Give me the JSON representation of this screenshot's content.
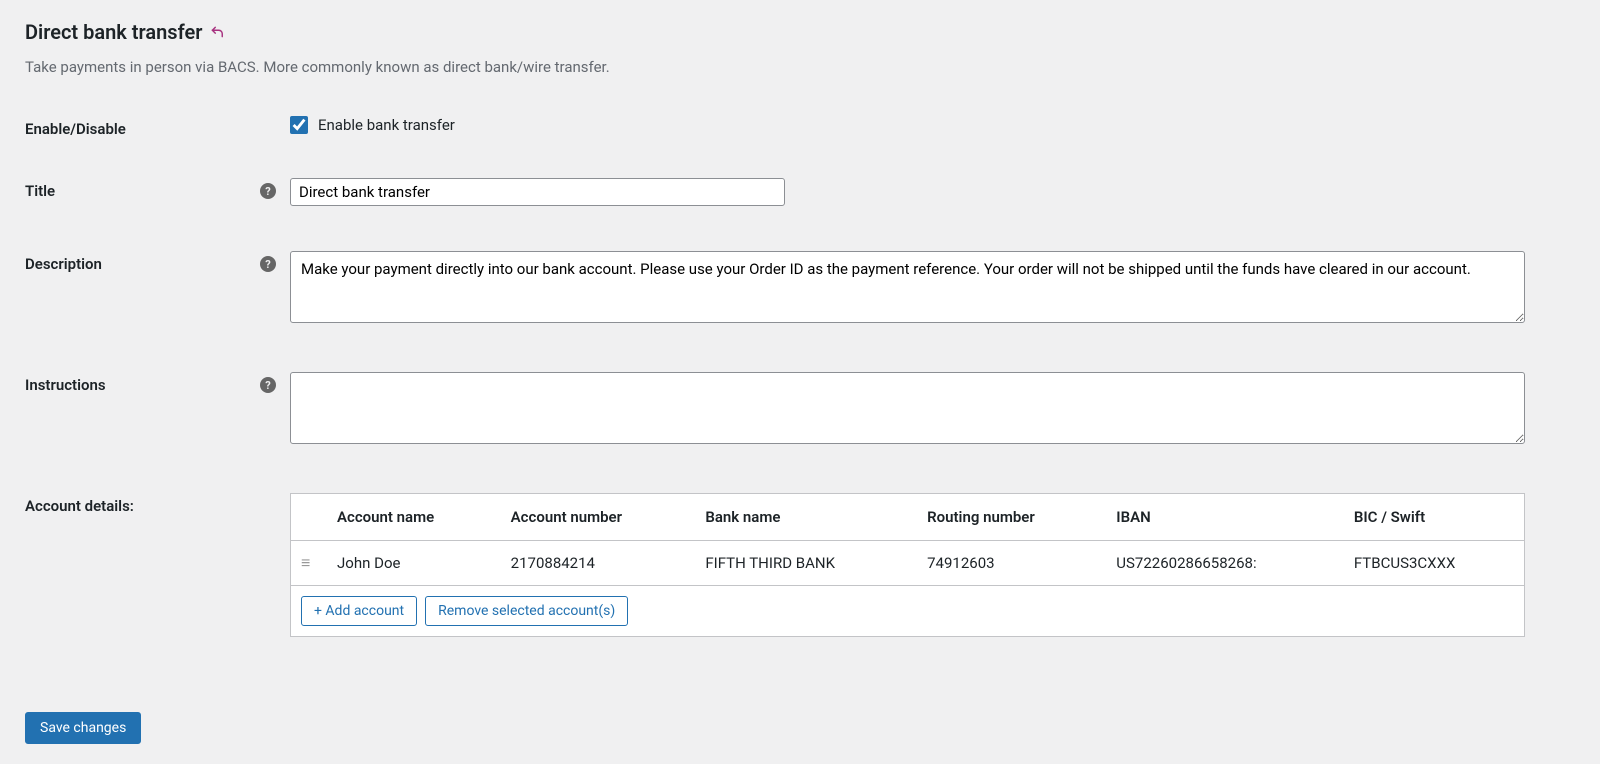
{
  "header": {
    "title": "Direct bank transfer",
    "subtitle": "Take payments in person via BACS. More commonly known as direct bank/wire transfer."
  },
  "form": {
    "enable_disable": {
      "label": "Enable/Disable",
      "checkbox_label": "Enable bank transfer",
      "checked": true
    },
    "title": {
      "label": "Title",
      "value": "Direct bank transfer"
    },
    "description": {
      "label": "Description",
      "value": "Make your payment directly into our bank account. Please use your Order ID as the payment reference. Your order will not be shipped until the funds have cleared in our account."
    },
    "instructions": {
      "label": "Instructions",
      "value": ""
    },
    "account_details": {
      "label": "Account details:",
      "columns": [
        "Account name",
        "Account number",
        "Bank name",
        "Routing number",
        "IBAN",
        "BIC / Swift"
      ],
      "rows": [
        {
          "name": "John Doe",
          "number": "2170884214",
          "bank": "FIFTH THIRD BANK",
          "routing": "74912603",
          "iban": "US72260286658268:",
          "bic": "FTBCUS3CXXX"
        }
      ],
      "add_label": "+ Add account",
      "remove_label": "Remove selected account(s)"
    }
  },
  "footer": {
    "save_label": "Save changes"
  }
}
